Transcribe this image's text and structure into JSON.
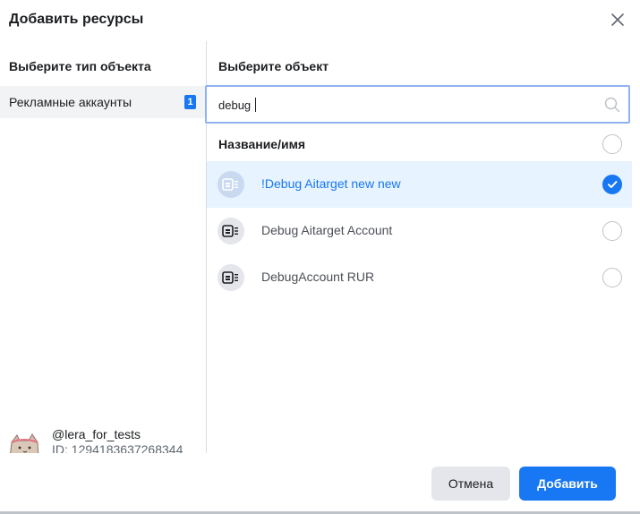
{
  "dialog": {
    "title": "Добавить ресурсы",
    "close_icon": "close-icon"
  },
  "left": {
    "heading": "Выберите тип объекта",
    "types": [
      {
        "label": "Рекламные аккаунты",
        "badge": "1",
        "selected": true
      }
    ],
    "user": {
      "name": "@lera_for_tests",
      "id": "ID: 1294183637268344",
      "avatar_icon": "cat-avatar"
    }
  },
  "right": {
    "heading": "Выберите объект",
    "search": {
      "value": "debug",
      "icon": "search-icon"
    },
    "list_header": "Название/имя",
    "items": [
      {
        "label": "!Debug Aitarget new new",
        "selected": true,
        "icon": "ad-account-icon"
      },
      {
        "label": "Debug Aitarget Account",
        "selected": false,
        "icon": "ad-account-icon"
      },
      {
        "label": "DebugAccount RUR",
        "selected": false,
        "icon": "ad-account-icon"
      }
    ]
  },
  "footer": {
    "cancel_label": "Отмена",
    "add_label": "Добавить"
  },
  "colors": {
    "accent": "#1877f2",
    "selected_row": "#e7f3ff",
    "search_border": "#8fb3f0"
  }
}
